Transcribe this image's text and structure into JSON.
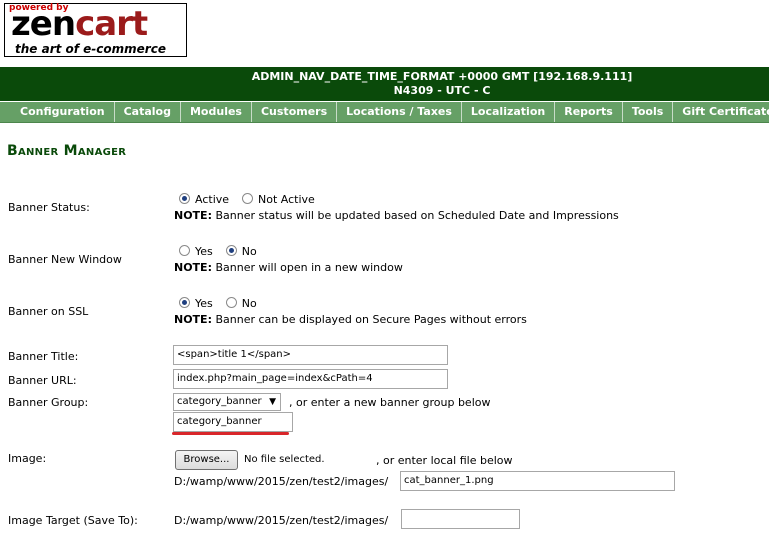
{
  "logo": {
    "powered_by": "powered by",
    "brand_zen": "zen",
    "brand_cart": "cart",
    "tagline": "the art of e-commerce"
  },
  "header": {
    "line1": "ADMIN_NAV_DATE_TIME_FORMAT +0000 GMT [192.168.9.111]",
    "line2": "N4309 - UTC - C"
  },
  "nav": [
    "Configuration",
    "Catalog",
    "Modules",
    "Customers",
    "Locations / Taxes",
    "Localization",
    "Reports",
    "Tools",
    "Gift Certificates"
  ],
  "page_title": "Banner Manager",
  "form": {
    "status": {
      "label": "Banner Status:",
      "opt_active": "Active",
      "opt_inactive": "Not Active",
      "selected": "Active",
      "note_label": "NOTE:",
      "note": "Banner status will be updated based on Scheduled Date and Impressions"
    },
    "new_window": {
      "label": "Banner New Window",
      "opt_yes": "Yes",
      "opt_no": "No",
      "selected": "No",
      "note_label": "NOTE:",
      "note": "Banner will open in a new window"
    },
    "ssl": {
      "label": "Banner on SSL",
      "opt_yes": "Yes",
      "opt_no": "No",
      "selected": "Yes",
      "note_label": "NOTE:",
      "note": "Banner can be displayed on Secure Pages without errors"
    },
    "title": {
      "label": "Banner Title:",
      "value": "<span>title 1</span>"
    },
    "url": {
      "label": "Banner URL:",
      "value": "index.php?main_page=index&cPath=4"
    },
    "group": {
      "label": "Banner Group:",
      "selected": "category_banner",
      "hint": ", or enter a new banner group below",
      "new_value": "category_banner"
    },
    "image": {
      "label": "Image:",
      "browse": "Browse...",
      "no_file": "No file selected.",
      "hint": ", or enter local file below",
      "path": "D:/wamp/www/2015/zen/test2/images/",
      "local_value": "cat_banner_1.png"
    },
    "target": {
      "label": "Image Target (Save To):",
      "path": "D:/wamp/www/2015/zen/test2/images/",
      "value": ""
    }
  }
}
